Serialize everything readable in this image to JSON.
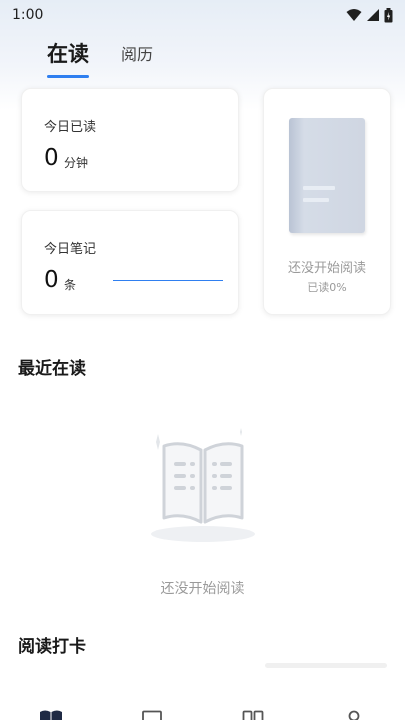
{
  "status_bar": {
    "time": "1:00"
  },
  "tabs": [
    {
      "label": "在读",
      "active": true
    },
    {
      "label": "阅历",
      "active": false
    }
  ],
  "today_read": {
    "label": "今日已读",
    "value": "0",
    "unit": "分钟"
  },
  "today_notes": {
    "label": "今日笔记",
    "value": "0",
    "unit": "条"
  },
  "current_book": {
    "status": "还没开始阅读",
    "progress": "已读0%"
  },
  "recent": {
    "title": "最近在读",
    "empty_text": "还没开始阅读"
  },
  "checkin": {
    "title": "阅读打卡"
  },
  "colors": {
    "accent": "#2f7ff0"
  },
  "icons": [
    "wifi-icon",
    "signal-icon",
    "battery-icon",
    "open-book-icon",
    "nav-bookshelf-icon",
    "nav-book-icon",
    "nav-columns-icon",
    "nav-profile-icon"
  ]
}
